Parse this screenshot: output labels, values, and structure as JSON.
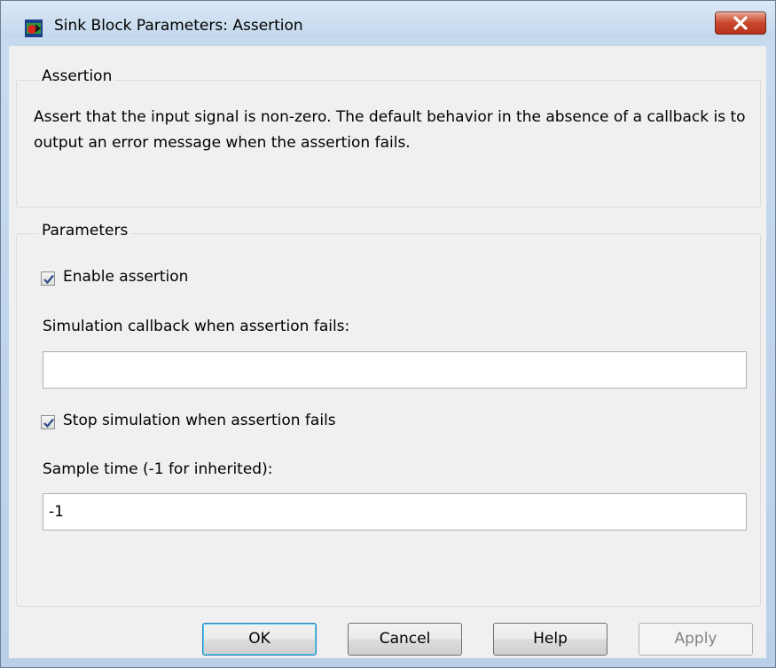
{
  "window": {
    "title": "Sink Block Parameters: Assertion"
  },
  "assertion_group": {
    "legend": "Assertion",
    "description": "Assert that the input signal is non-zero.  The default behavior in the absence of a callback is to output an error message when the assertion fails."
  },
  "parameters_group": {
    "legend": "Parameters",
    "enable_assertion": {
      "label": "Enable assertion",
      "checked": true
    },
    "callback": {
      "label": "Simulation callback when assertion fails:",
      "value": ""
    },
    "stop_simulation": {
      "label": "Stop simulation when assertion fails",
      "checked": true
    },
    "sample_time": {
      "label": "Sample time (-1 for inherited):",
      "value": "-1"
    }
  },
  "buttons": {
    "ok": "OK",
    "cancel": "Cancel",
    "help": "Help",
    "apply": "Apply"
  },
  "colors": {
    "title_bar": "#c7dbef",
    "client_bg": "#f0f0f0",
    "close_button": "#c9462c",
    "checkmark": "#2a4a8a"
  },
  "icons": {
    "app": "simulink-block-icon",
    "close": "close-icon",
    "check": "checkmark-icon"
  }
}
